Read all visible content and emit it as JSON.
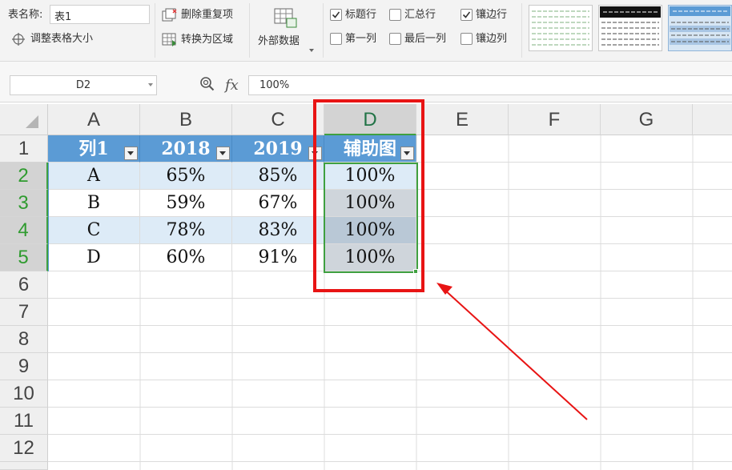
{
  "ribbon": {
    "table_name_label": "表名称:",
    "table_name_value": "表1",
    "resize_table_label": "调整表格大小",
    "remove_duplicates_label": "删除重复项",
    "convert_to_range_label": "转换为区域",
    "external_data_label": "外部数据",
    "options": [
      {
        "label": "标题行",
        "checked": true
      },
      {
        "label": "汇总行",
        "checked": false
      },
      {
        "label": "镶边行",
        "checked": true
      },
      {
        "label": "第一列",
        "checked": false
      },
      {
        "label": "最后一列",
        "checked": false
      },
      {
        "label": "镶边列",
        "checked": false
      }
    ]
  },
  "formula_bar": {
    "name_box": "D2",
    "fx_label": "fx",
    "formula": "100%"
  },
  "columns": [
    "A",
    "B",
    "C",
    "D",
    "E",
    "F",
    "G"
  ],
  "rows": [
    "1",
    "2",
    "3",
    "4",
    "5",
    "6",
    "7",
    "8",
    "9",
    "10",
    "11",
    "12"
  ],
  "table": {
    "headers": [
      "列1",
      "2018",
      "2019",
      "辅助图"
    ],
    "data": [
      [
        "A",
        "65%",
        "85%",
        "100%"
      ],
      [
        "B",
        "59%",
        "67%",
        "100%"
      ],
      [
        "C",
        "78%",
        "83%",
        "100%"
      ],
      [
        "D",
        "60%",
        "91%",
        "100%"
      ]
    ]
  },
  "colors": {
    "table_header": "#5b9bd5",
    "band_row": "#ddebf7",
    "selection": "#3fa040",
    "annotation": "#e81414"
  }
}
